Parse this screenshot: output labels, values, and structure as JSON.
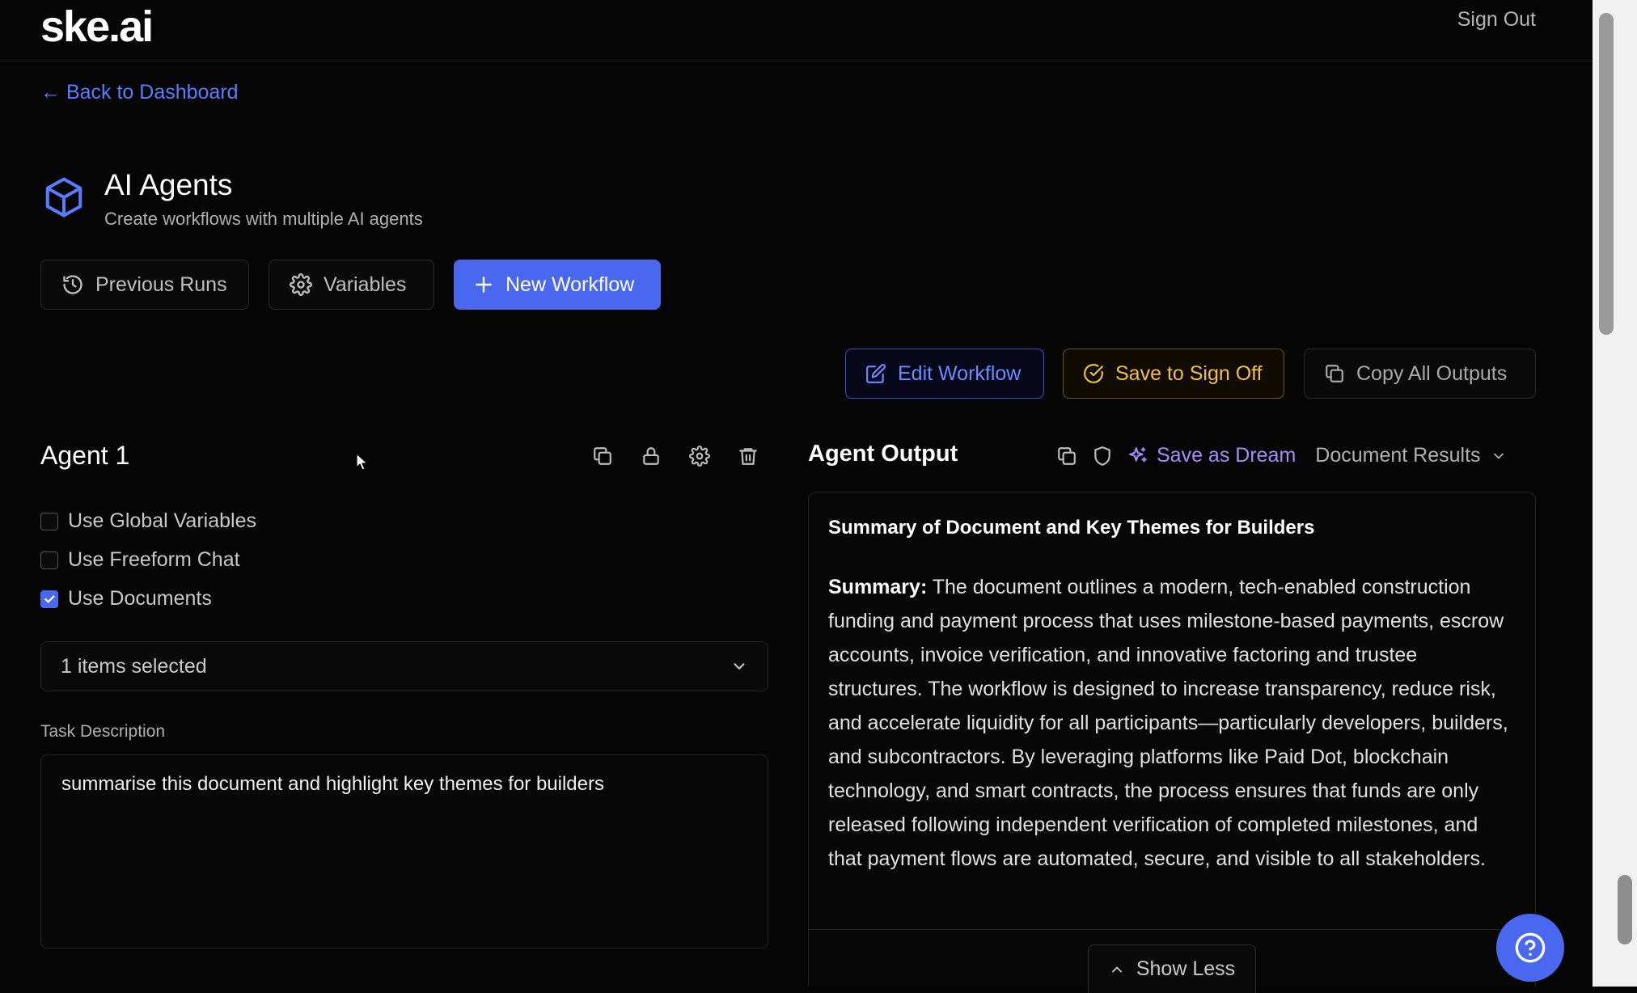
{
  "header": {
    "logo": "ske.ai",
    "sign_out": "Sign Out"
  },
  "nav": {
    "back_link": "← Back to Dashboard"
  },
  "page": {
    "title": "AI Agents",
    "subtitle": "Create workflows with multiple AI agents",
    "icon": "cube-icon"
  },
  "toolbar": {
    "previous_runs": "Previous Runs",
    "variables": "Variables",
    "new_workflow": "New Workflow"
  },
  "actions": {
    "edit_workflow": "Edit Workflow",
    "save_to_sign_off": "Save to Sign Off",
    "copy_all_outputs": "Copy All Outputs"
  },
  "agent": {
    "title": "Agent 1",
    "options": [
      {
        "label": "Use Global Variables",
        "checked": false
      },
      {
        "label": "Use Freeform Chat",
        "checked": false
      },
      {
        "label": "Use Documents",
        "checked": true
      }
    ],
    "documents_select": "1 items selected",
    "task_label": "Task Description",
    "task_value": "summarise this document and highlight key themes for builders"
  },
  "output": {
    "title": "Agent Output",
    "save_as_dream": "Save as Dream",
    "document_results": "Document Results",
    "heading": "Summary of Document and Key Themes for Builders",
    "summary_label": "Summary:",
    "summary_text": " The document outlines a modern, tech-enabled construction funding and payment process that uses milestone-based payments, escrow accounts, invoice verification, and innovative factoring and trustee structures. The workflow is designed to increase transparency, reduce risk, and accelerate liquidity for all participants—particularly developers, builders, and subcontractors. By leveraging platforms like Paid Dot, blockchain technology, and smart contracts, the process ensures that funds are only released following independent verification of completed milestones, and that payment flows are automated, secure, and visible to all stakeholders.",
    "show_less": "Show Less"
  },
  "colors": {
    "accent": "#4a67f0",
    "link": "#5a7cff",
    "amber": "#f3c13a",
    "violet": "#a78bfa",
    "background": "#050505"
  }
}
